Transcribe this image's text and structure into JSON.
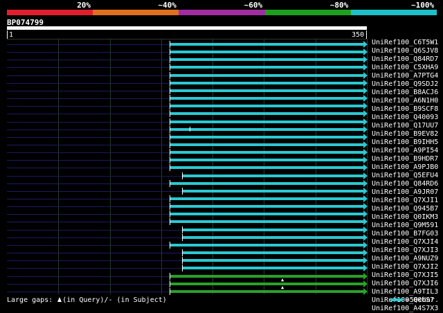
{
  "scale": {
    "labels": [
      "20%",
      "~40%",
      "~60%",
      "~80%",
      "~100%"
    ],
    "colors": [
      "#e01e2e",
      "#e0701e",
      "#a02ea0",
      "#1ea01e",
      "#1ec0c8"
    ]
  },
  "query": {
    "id": "BP074799",
    "length": 350,
    "tick_start": "1",
    "tick_end": "350"
  },
  "hits": [
    {
      "name": "UniRef100_C6T5W1",
      "start": 160,
      "end": 350,
      "color": "#2ac9d2",
      "gap": null
    },
    {
      "name": "UniRef100_Q6SJV8",
      "start": 160,
      "end": 350,
      "color": "#2ac9d2",
      "gap": null
    },
    {
      "name": "UniRef100_Q84RD7",
      "start": 160,
      "end": 350,
      "color": "#2ac9d2",
      "gap": null
    },
    {
      "name": "UniRef100_C5XHA9",
      "start": 160,
      "end": 350,
      "color": "#2ac9d2",
      "gap": null
    },
    {
      "name": "UniRef100_A7PTG4",
      "start": 160,
      "end": 350,
      "color": "#2ac9d2",
      "gap": null
    },
    {
      "name": "UniRef100_Q9SDJ2",
      "start": 160,
      "end": 350,
      "color": "#2ac9d2",
      "gap": null
    },
    {
      "name": "UniRef100_B8ACJ6",
      "start": 160,
      "end": 350,
      "color": "#2ac9d2",
      "gap": null
    },
    {
      "name": "UniRef100_A6N1H0",
      "start": 160,
      "end": 350,
      "color": "#2ac9d2",
      "gap": null
    },
    {
      "name": "UniRef100_B9SCF8",
      "start": 160,
      "end": 350,
      "color": "#2ac9d2",
      "gap": null
    },
    {
      "name": "UniRef100_Q40093",
      "start": 160,
      "end": 350,
      "color": "#2ac9d2",
      "gap": null
    },
    {
      "name": "UniRef100_Q17UU7",
      "start": 160,
      "end": 350,
      "color": "#2ac9d2",
      "gap": null
    },
    {
      "name": "UniRef100_B9EV82",
      "start": 160,
      "end": 350,
      "color": "#2ac9d2",
      "gap": 180
    },
    {
      "name": "UniRef100_B9IHH5",
      "start": 160,
      "end": 350,
      "color": "#2ac9d2",
      "gap": null
    },
    {
      "name": "UniRef100_A9PI54",
      "start": 160,
      "end": 350,
      "color": "#2ac9d2",
      "gap": null
    },
    {
      "name": "UniRef100_B9HDR7",
      "start": 160,
      "end": 350,
      "color": "#2ac9d2",
      "gap": null
    },
    {
      "name": "UniRef100_A9PJB0",
      "start": 160,
      "end": 350,
      "color": "#2ac9d2",
      "gap": null
    },
    {
      "name": "UniRef100_Q5EFU4",
      "start": 160,
      "end": 350,
      "color": "#2ac9d2",
      "gap": null
    },
    {
      "name": "UniRef100_Q84RD6",
      "start": 172,
      "end": 350,
      "color": "#2ac9d2",
      "gap": null
    },
    {
      "name": "UniRef100_A9JR07",
      "start": 160,
      "end": 350,
      "color": "#2ac9d2",
      "gap": null
    },
    {
      "name": "UniRef100_Q7XJI1",
      "start": 172,
      "end": 350,
      "color": "#2ac9d2",
      "gap": null
    },
    {
      "name": "UniRef100_Q945B7",
      "start": 160,
      "end": 350,
      "color": "#2ac9d2",
      "gap": null
    },
    {
      "name": "UniRef100_Q0IKM3",
      "start": 160,
      "end": 350,
      "color": "#2ac9d2",
      "gap": null
    },
    {
      "name": "UniRef100_Q9M591",
      "start": 160,
      "end": 350,
      "color": "#2ac9d2",
      "gap": null
    },
    {
      "name": "UniRef100_B7FG03",
      "start": 160,
      "end": 350,
      "color": "#2ac9d2",
      "gap": null
    },
    {
      "name": "UniRef100_Q7XJI4",
      "start": 172,
      "end": 350,
      "color": "#2ac9d2",
      "gap": null
    },
    {
      "name": "UniRef100_Q7XJI3",
      "start": 172,
      "end": 350,
      "color": "#2ac9d2",
      "gap": null
    },
    {
      "name": "UniRef100_A9NUZ9",
      "start": 160,
      "end": 350,
      "color": "#2ac9d2",
      "gap": null
    },
    {
      "name": "UniRef100_Q7XJI2",
      "start": 172,
      "end": 350,
      "color": "#2ac9d2",
      "gap": null
    },
    {
      "name": "UniRef100_Q7XJI5",
      "start": 172,
      "end": 350,
      "color": "#2ac9d2",
      "gap": null
    },
    {
      "name": "UniRef100_Q7XJI6",
      "start": 172,
      "end": 350,
      "color": "#2ac9d2",
      "gap": null
    },
    {
      "name": "UniRef100_A9TIL3",
      "start": 160,
      "end": 350,
      "color": "#2aa02a",
      "gap": null
    },
    {
      "name": "UniRef100_Q0US7",
      "start": 160,
      "end": 350,
      "color": "#2aa02a",
      "gap": 272
    },
    {
      "name": "UniRef100_A4S7X3",
      "start": 160,
      "end": 350,
      "color": "#2aa02a",
      "gap": 272
    }
  ],
  "footer": {
    "gaps_prefix": "Large gaps:",
    "gaps_query": "(in Query)/",
    "gaps_subject": "- (in Subject)",
    "scale_text": "=50char."
  }
}
